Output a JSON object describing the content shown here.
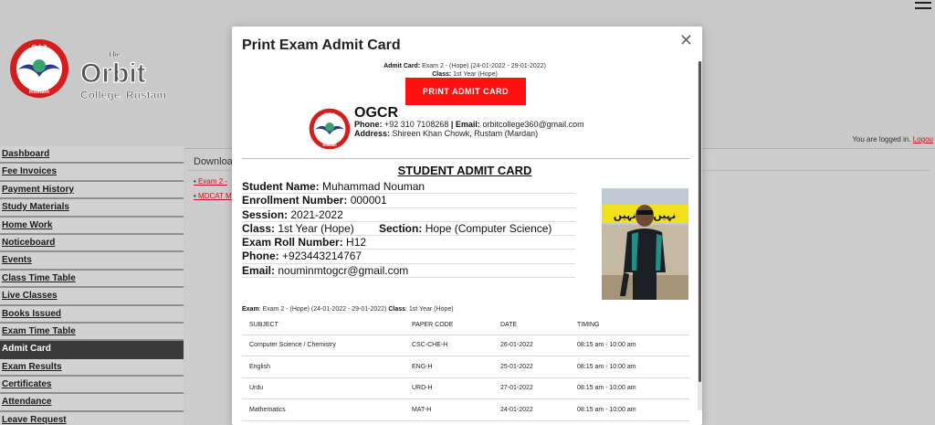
{
  "header": {
    "logged_in_text": "You are logged in.",
    "logout_label": "Logou"
  },
  "brand": {
    "seal_top_text": "Orbit",
    "seal_bottom_text": "Rustam",
    "name_the": "The",
    "name_main": "Orbit",
    "name_sub": "College. Rustam"
  },
  "sidebar": {
    "items": [
      {
        "label": "Dashboard"
      },
      {
        "label": "Fee Invoices"
      },
      {
        "label": "Payment History"
      },
      {
        "label": "Study Materials"
      },
      {
        "label": "Home Work"
      },
      {
        "label": "Noticeboard"
      },
      {
        "label": "Events"
      },
      {
        "label": "Class Time Table"
      },
      {
        "label": "Live Classes"
      },
      {
        "label": "Books Issued"
      },
      {
        "label": "Exam Time Table"
      },
      {
        "label": "Admit Card"
      },
      {
        "label": "Exam Results"
      },
      {
        "label": "Certificates"
      },
      {
        "label": "Attendance"
      },
      {
        "label": "Leave Request"
      }
    ],
    "active": "Admit Card"
  },
  "content": {
    "title": "Downloa",
    "links": [
      "Exam 2 -",
      "MDCAT M"
    ]
  },
  "modal": {
    "title": "Print Exam Admit Card",
    "close_icon": "close-icon",
    "admit_card_label": "Admit Card:",
    "admit_card_value": "Exam 2 - (Hope) (24-01-2022 - 29-01-2022)",
    "class_label": "Class:",
    "class_value": "1st Year (Hope)",
    "print_button": "PRINT ADMIT CARD",
    "college": {
      "name": "OGCR",
      "phone_label": "Phone:",
      "phone_value": "+92 310 7108268",
      "sep": "|",
      "email_label": "Email:",
      "email_value": "orbitcollege360@gmail.com",
      "address_label": "Address:",
      "address_value": "Shireen Khan Chowk, Rustam (Mardan)"
    },
    "card_title": "STUDENT ADMIT CARD",
    "student": {
      "name_label": "Student Name:",
      "name_value": "Muhammad Nouman",
      "enroll_label": "Enrollment Number:",
      "enroll_value": "000001",
      "session_label": "Session:",
      "session_value": "2021-2022",
      "class_label": "Class:",
      "class_value": "1st Year (Hope)",
      "section_label": "Section:",
      "section_value": "Hope (Computer Science)",
      "roll_label": "Exam Roll Number:",
      "roll_value": "H12",
      "phone_label": "Phone:",
      "phone_value": "+923443214767",
      "email_label": "Email:",
      "email_value": "nouminmtogcr@gmail.com"
    },
    "photo_banner_text": "نہیں تو نہیں",
    "exam_line": {
      "exam_label": "Exam",
      "exam_value": ": Exam 2 - (Hope) (24-01-2022 - 29-01-2022)",
      "class_label": "Class",
      "class_value": ": 1st Year (Hope)"
    },
    "table": {
      "headers": [
        "SUBJECT",
        "PAPER CODE",
        "DATE",
        "TIMING"
      ],
      "rows": [
        [
          "Computer Science / Chemistry",
          "CSC-CHE-H",
          "26-01-2022",
          "08:15 am - 10:00 am"
        ],
        [
          "English",
          "ENG-H",
          "25-01-2022",
          "08:15 am - 10:00 am"
        ],
        [
          "Urdu",
          "URD-H",
          "27-01-2022",
          "08:15 am - 10:00 am"
        ],
        [
          "Mathematics",
          "MAT-H",
          "24-01-2022",
          "08:15 am - 10:00 am"
        ]
      ]
    }
  },
  "colors": {
    "accent_red": "#ff1111",
    "link_red": "#c4161c",
    "active_nav": "#3a3a3a"
  }
}
